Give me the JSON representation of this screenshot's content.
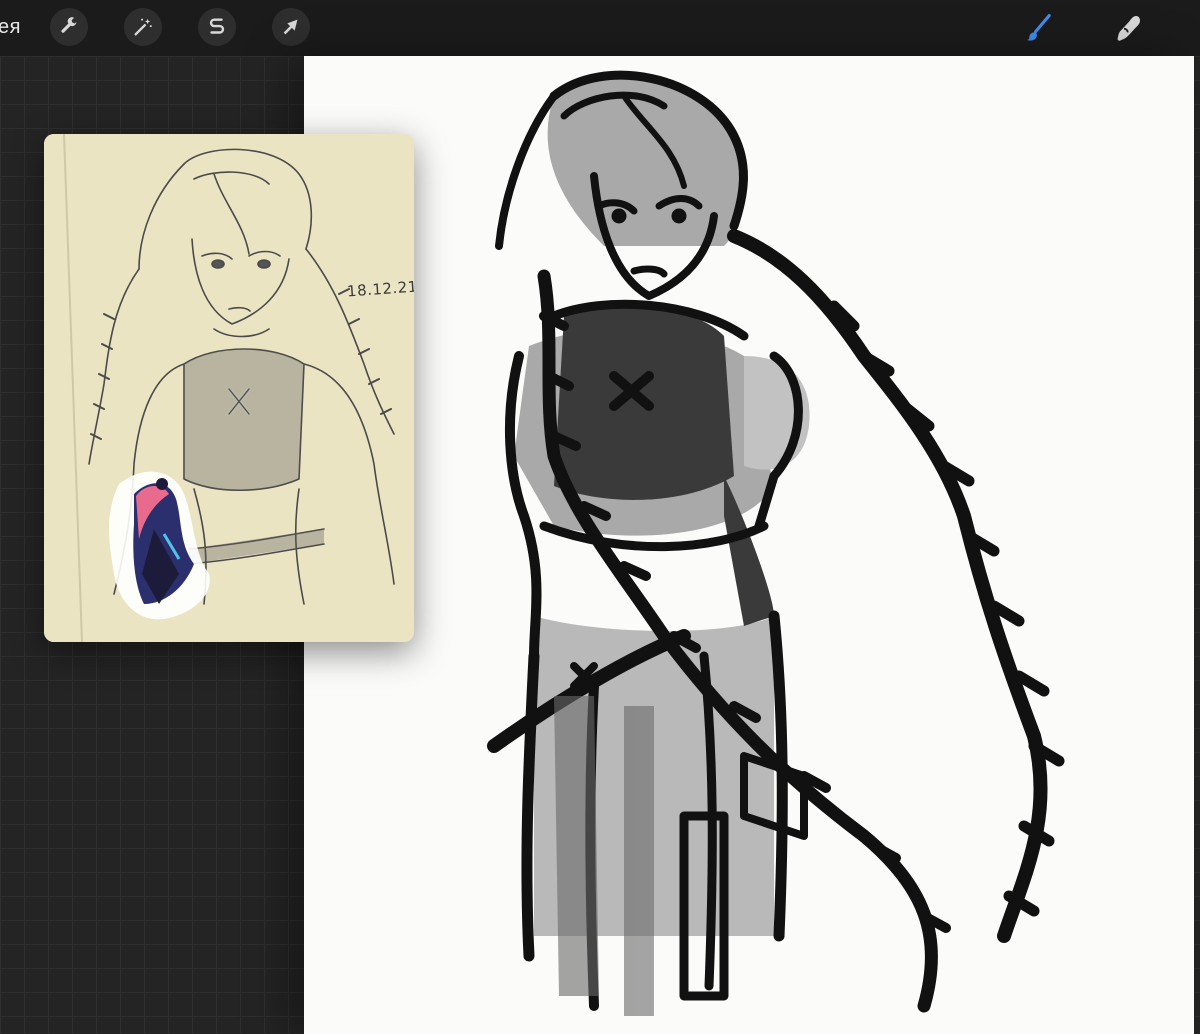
{
  "toolbar": {
    "gallery_label": "ея",
    "tools_left": [
      {
        "name": "actions",
        "icon": "wrench-icon"
      },
      {
        "name": "adjustments",
        "icon": "magic-wand-icon"
      },
      {
        "name": "selection",
        "icon": "selection-s-icon"
      },
      {
        "name": "transform",
        "icon": "arrow-cursor-icon"
      }
    ],
    "tools_right": [
      {
        "name": "brush",
        "icon": "brush-icon",
        "active": true
      },
      {
        "name": "smudge",
        "icon": "smudge-finger-icon",
        "active": false
      }
    ],
    "accent_color": "#3d8ef0"
  },
  "reference": {
    "date_text": "18.12.21"
  },
  "colors": {
    "canvas_bg": "#fbfbf9",
    "workspace_bg": "#242424",
    "paper": "#e9e2bf"
  }
}
